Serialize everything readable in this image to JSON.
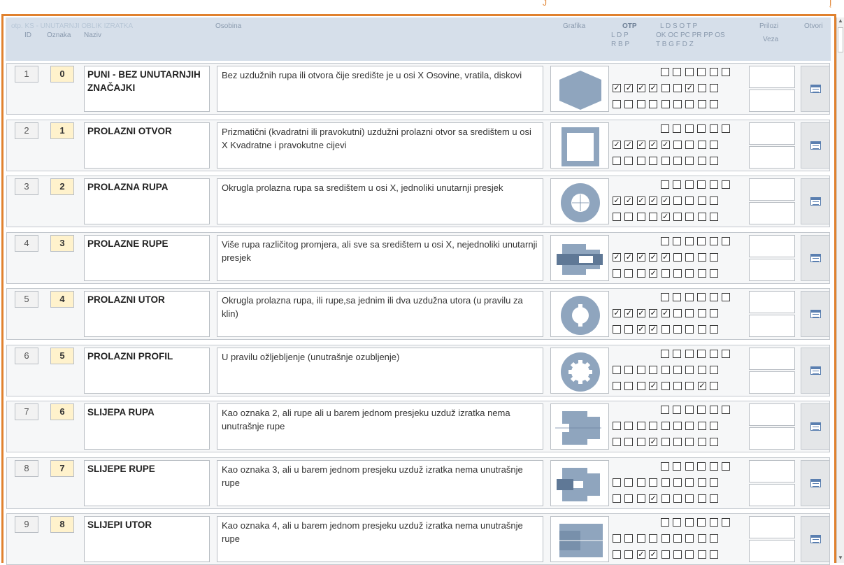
{
  "header": {
    "form_title": "otp. KS - UNUTARNJI OBLIK IZRATKA",
    "col_id": "ID",
    "col_oznaka": "Oznaka",
    "col_naziv": "Naziv",
    "col_osobina": "Osobina",
    "col_grafika": "Grafika",
    "otp": "OTP",
    "otp_row1": "L   D   P",
    "otp_row2": "R   B   P",
    "letters_row1": "L   D   S   O   T   P",
    "letters_row2": "OK OC PC PR PP OS",
    "letters_row3": "T   B   G   F   D   Z",
    "col_prilozi": "Prilozi",
    "col_veza": "Veza",
    "col_otvori": "Otvori"
  },
  "top_marks": [
    "J",
    "Į"
  ],
  "accent_color": "#e0812e",
  "records": [
    {
      "id": "1",
      "oznaka": "0",
      "naziv": "PUNI - BEZ UNUTARNJIH ZNAČAJKI",
      "osobina": "Bez uzdužnih rupa ili otvora čije središte je u osi X Osovine, vratila, diskovi",
      "graphic": "hexagon",
      "top": [
        0,
        0,
        0,
        0,
        0,
        0
      ],
      "mid": [
        1,
        1,
        1,
        1,
        0,
        0,
        1,
        0,
        0
      ],
      "bot": [
        0,
        0,
        0,
        0,
        0,
        0,
        0,
        0,
        0
      ]
    },
    {
      "id": "2",
      "oznaka": "1",
      "naziv": "PROLAZNI OTVOR",
      "osobina": "Prizmatični (kvadratni ili pravokutni) uzdužni prolazni otvor sa središtem u osi X Kvadratne i pravokutne cijevi",
      "graphic": "square-tube",
      "top": [
        0,
        0,
        0,
        0,
        0,
        0
      ],
      "mid": [
        1,
        1,
        1,
        1,
        1,
        0,
        0,
        0,
        0
      ],
      "bot": [
        0,
        0,
        0,
        0,
        0,
        0,
        0,
        0,
        0
      ]
    },
    {
      "id": "3",
      "oznaka": "2",
      "naziv": "PROLAZNA RUPA",
      "osobina": "Okrugla prolazna rupa sa središtem u osi X, jednoliki unutarnji presjek",
      "graphic": "ring",
      "top": [
        0,
        0,
        0,
        0,
        0,
        0
      ],
      "mid": [
        1,
        1,
        1,
        1,
        1,
        0,
        0,
        0,
        0
      ],
      "bot": [
        0,
        0,
        0,
        0,
        1,
        0,
        0,
        0,
        0
      ]
    },
    {
      "id": "4",
      "oznaka": "3",
      "naziv": "PROLAZNE RUPE",
      "osobina": "Više rupa različitog promjera, ali sve sa središtem u osi X, nejednoliki unutarnji presjek",
      "graphic": "stepped-shaft",
      "top": [
        0,
        0,
        0,
        0,
        0,
        0
      ],
      "mid": [
        1,
        1,
        1,
        1,
        1,
        0,
        0,
        0,
        0
      ],
      "bot": [
        0,
        0,
        0,
        1,
        0,
        0,
        0,
        0,
        0
      ]
    },
    {
      "id": "5",
      "oznaka": "4",
      "naziv": "PROLAZNI UTOR",
      "osobina": "Okrugla prolazna rupa, ili rupe,sa jednim ili dva uzdužna utora (u pravilu za klin)",
      "graphic": "ring-keyway",
      "top": [
        0,
        0,
        0,
        0,
        0,
        0
      ],
      "mid": [
        1,
        1,
        1,
        1,
        1,
        0,
        0,
        0,
        0
      ],
      "bot": [
        0,
        0,
        1,
        1,
        0,
        0,
        0,
        0,
        0
      ]
    },
    {
      "id": "6",
      "oznaka": "5",
      "naziv": "PROLAZNI PROFIL",
      "osobina": "U pravilu ožljebljenje (unutrašnje ozubljenje)",
      "graphic": "spline-ring",
      "top": [
        0,
        0,
        0,
        0,
        0,
        0
      ],
      "mid": [
        0,
        0,
        0,
        0,
        0,
        0,
        0,
        0,
        0
      ],
      "bot": [
        0,
        0,
        0,
        1,
        0,
        0,
        0,
        1,
        0
      ]
    },
    {
      "id": "7",
      "oznaka": "6",
      "naziv": "SLIJEPA RUPA",
      "osobina": "Kao oznaka 2, ali rupe ali u barem jednom presjeku uzduž izratka nema unutrašnje rupe",
      "graphic": "blind-hole",
      "top": [
        0,
        0,
        0,
        0,
        0,
        0
      ],
      "mid": [
        0,
        0,
        0,
        0,
        0,
        0,
        0,
        0,
        0
      ],
      "bot": [
        0,
        0,
        0,
        1,
        0,
        0,
        0,
        0,
        0
      ]
    },
    {
      "id": "8",
      "oznaka": "7",
      "naziv": "SLIJEPE RUPE",
      "osobina": "Kao oznaka 3, ali u barem jednom presjeku uzduž izratka nema unutrašnje rupe",
      "graphic": "blind-holes",
      "top": [
        0,
        0,
        0,
        0,
        0,
        0
      ],
      "mid": [
        0,
        0,
        0,
        0,
        0,
        0,
        0,
        0,
        0
      ],
      "bot": [
        0,
        0,
        0,
        1,
        0,
        0,
        0,
        0,
        0
      ]
    },
    {
      "id": "9",
      "oznaka": "8",
      "naziv": "SLIJEPI UTOR",
      "osobina": "Kao oznaka 4, ali u barem jednom presjeku uzduž izratka nema unutrašnje rupe",
      "graphic": "blind-slot",
      "top": [
        0,
        0,
        0,
        0,
        0,
        0
      ],
      "mid": [
        0,
        0,
        0,
        0,
        0,
        0,
        0,
        0,
        0
      ],
      "bot": [
        0,
        0,
        1,
        1,
        0,
        0,
        0,
        0,
        0
      ]
    }
  ]
}
